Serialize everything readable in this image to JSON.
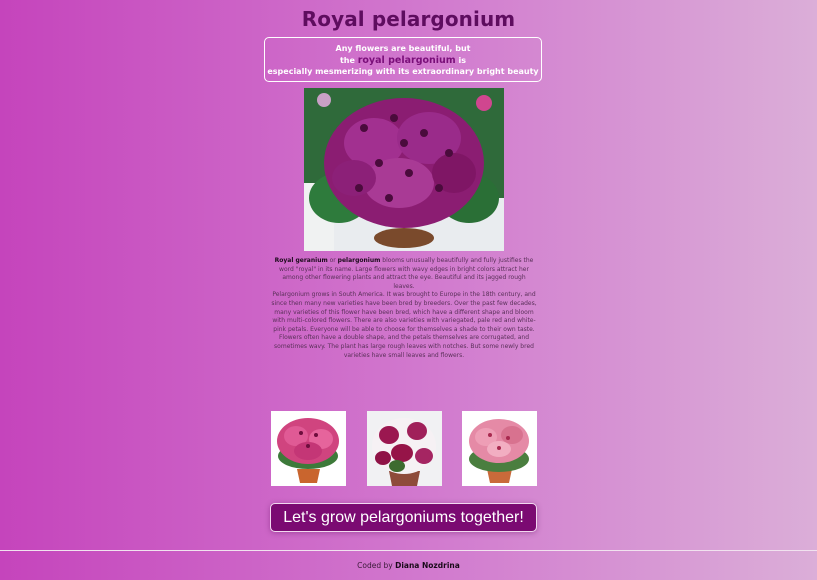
{
  "header": {
    "title": "Royal pelargonium"
  },
  "intro": {
    "line1": "Any flowers are beautiful, but",
    "line2_prefix": "the",
    "highlight": "royal pelargonium",
    "line2_suffix": "is",
    "line3": "especially mesmerizing with its extraordinary bright beauty"
  },
  "description": {
    "p1_bold1": "Royal geranium",
    "p1_or": " or ",
    "p1_bold2": "pelargonium",
    "p1_rest": " blooms unusually beautifully and fully justifies the word \"royal\" in its name. Large flowers with wavy edges in bright colors attract her among other flowering plants and attract the eye. Beautiful and its jagged rough leaves.",
    "p2": "Pelargonium grows in South America. It was brought to Europe in the 18th century, and since then many new varieties have been bred by breeders. Over the past few decades, many varieties of this flower have been bred, which have a different shape and bloom with multi-colored flowers. There are also varieties with variegated, pale red and white-pink petals. Everyone will be able to choose for themselves a shade to their own taste. Flowers often have a double shape, and the petals themselves are corrugated, and sometimes wavy. The plant has large rough leaves with notches. But some newly bred varieties have small leaves and flowers."
  },
  "cta": {
    "label": "Let's grow pelargoniums together!"
  },
  "footer": {
    "prefix": "Coded by",
    "author": "Diana Nozdrina"
  },
  "colors": {
    "accent": "#7b0a72",
    "title": "#5e0d5f",
    "bg_left": "#c544bc",
    "bg_right": "#dbaed8"
  }
}
